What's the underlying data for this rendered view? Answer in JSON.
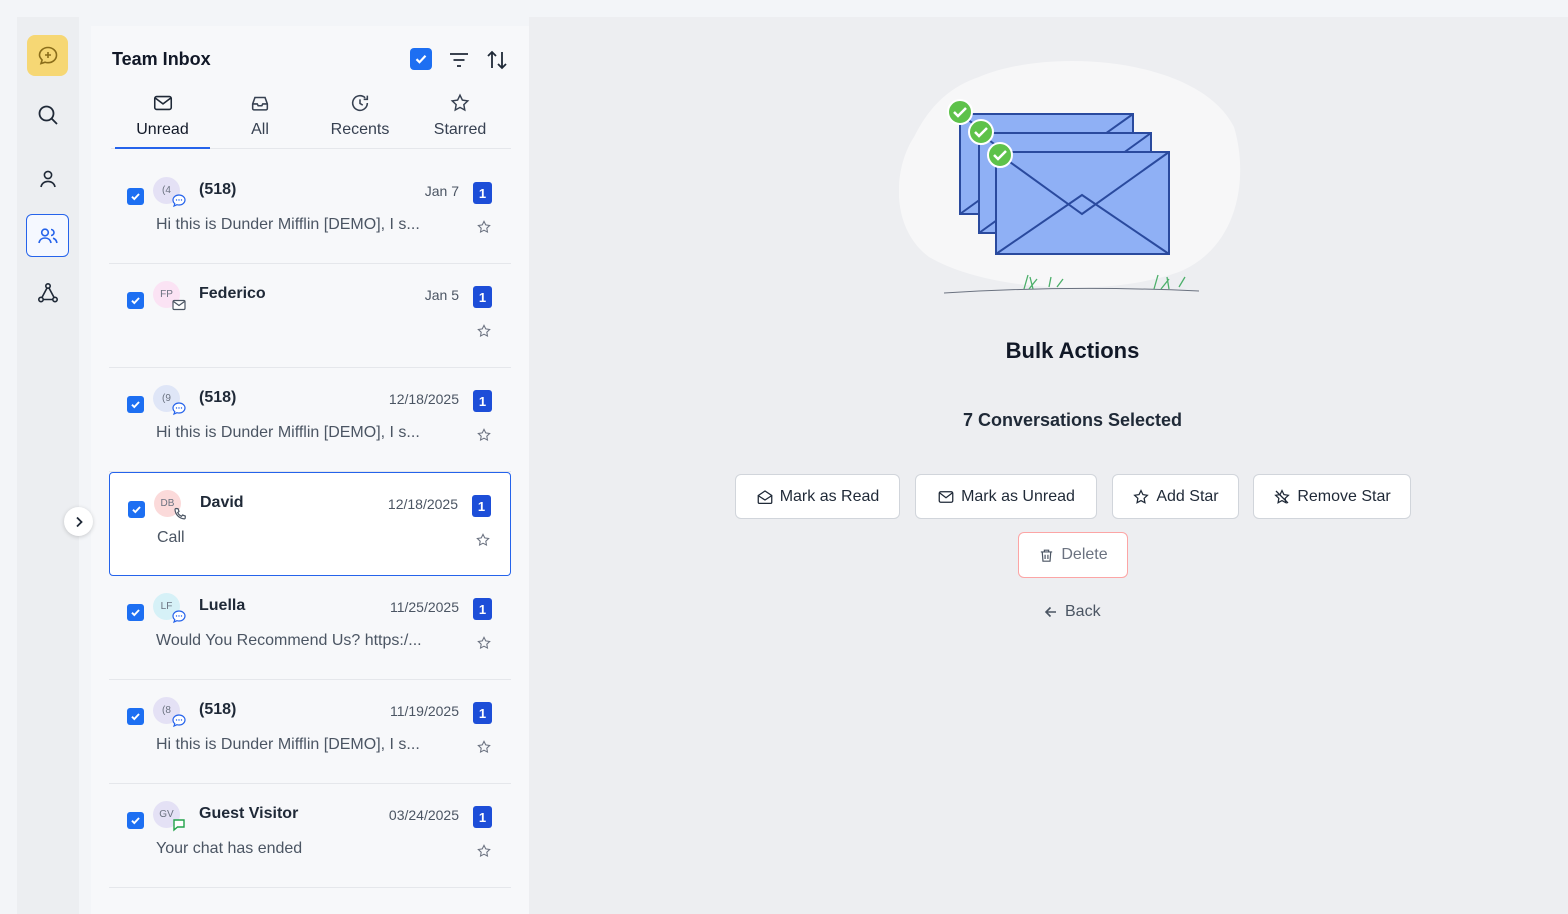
{
  "inbox": {
    "title": "Team Inbox",
    "tabs": [
      {
        "label": "Unread",
        "icon": "envelope-icon"
      },
      {
        "label": "All",
        "icon": "inbox-tray-icon"
      },
      {
        "label": "Recents",
        "icon": "history-icon"
      },
      {
        "label": "Starred",
        "icon": "star-icon"
      }
    ],
    "active_tab": "Unread",
    "conversations": [
      {
        "avatar": "(4",
        "name": "(518)",
        "date": "Jan 7",
        "unread": "1",
        "preview": "Hi this is Dunder Mifflin [DEMO], I s...",
        "channel": "sms",
        "selected": false
      },
      {
        "avatar": "FP",
        "name": "Federico",
        "date": "Jan 5",
        "unread": "1",
        "preview": "",
        "channel": "email",
        "selected": false
      },
      {
        "avatar": "(9",
        "name": "(518)",
        "date": "12/18/2025",
        "unread": "1",
        "preview": "Hi this is Dunder Mifflin [DEMO], I s...",
        "channel": "sms",
        "selected": false
      },
      {
        "avatar": "DB",
        "name": "David",
        "date": "12/18/2025",
        "unread": "1",
        "preview": "Call",
        "channel": "call",
        "selected": true
      },
      {
        "avatar": "LF",
        "name": "Luella",
        "date": "11/25/2025",
        "unread": "1",
        "preview": "Would You Recommend Us? https:/...",
        "channel": "sms",
        "selected": false
      },
      {
        "avatar": "(8",
        "name": "(518)",
        "date": "11/19/2025",
        "unread": "1",
        "preview": "Hi this is Dunder Mifflin [DEMO], I s...",
        "channel": "sms",
        "selected": false
      },
      {
        "avatar": "GV",
        "name": "Guest Visitor",
        "date": "03/24/2025",
        "unread": "1",
        "preview": "Your chat has ended",
        "channel": "chat",
        "selected": false
      }
    ]
  },
  "bulk": {
    "title": "Bulk Actions",
    "selected_text": "7 Conversations Selected",
    "mark_read": "Mark as Read",
    "mark_unread": "Mark as Unread",
    "add_star": "Add Star",
    "remove_star": "Remove Star",
    "delete": "Delete",
    "back": "Back"
  },
  "colors": {
    "accent": "#1d6ff2",
    "brand": "#f6d774",
    "badge": "#1d4ed8",
    "danger_border": "#fca5a5"
  }
}
